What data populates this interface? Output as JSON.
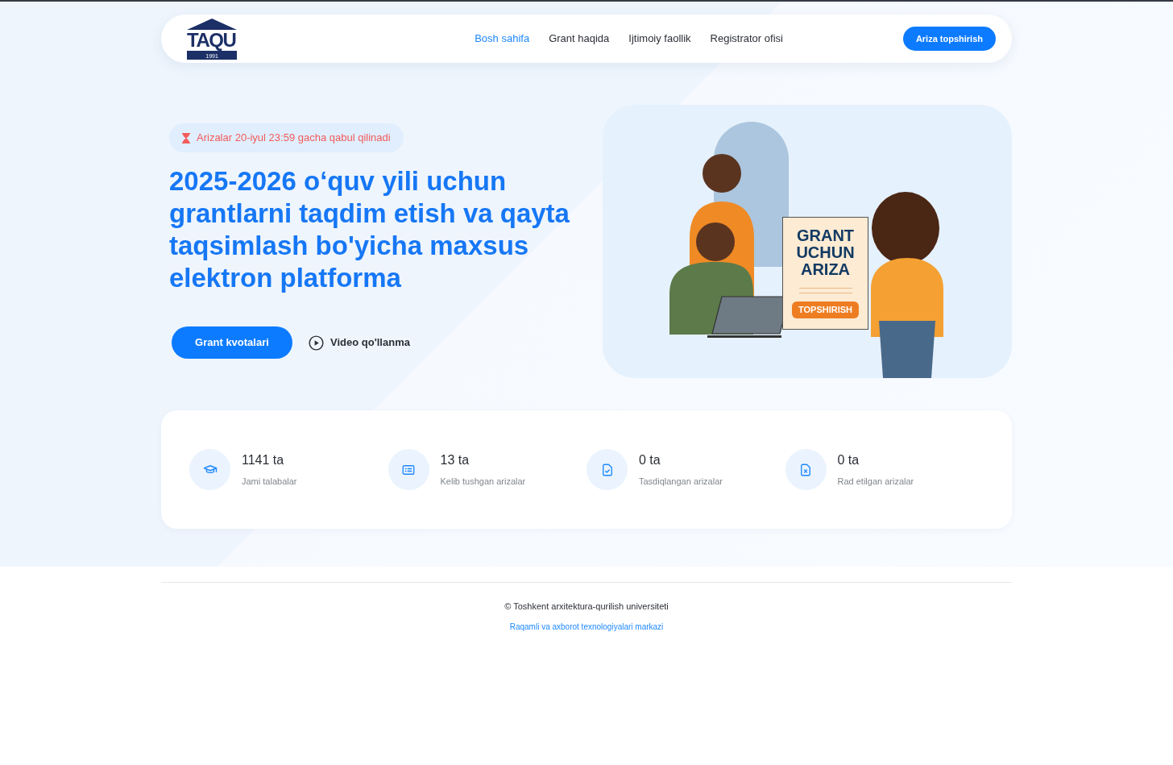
{
  "header": {
    "logo": {
      "text": "TAQU",
      "year": "1991"
    },
    "nav": [
      {
        "label": "Bosh sahifa",
        "selected": true
      },
      {
        "label": "Grant haqida",
        "selected": false
      },
      {
        "label": "Ijtimoiy faollik",
        "selected": false
      },
      {
        "label": "Registrator ofisi",
        "selected": false
      }
    ],
    "cta": "Ariza topshirish"
  },
  "hero": {
    "deadline": "Arizalar 20-iyul 23:59 gacha qabul qilinadi",
    "title": "2025-2026 o‘quv yili uchun grantlarni taqdim etish va qayta taqsimlash bo'yicha maxsus elektron platforma",
    "primary_button": "Grant kvotalari",
    "video_link": "Video qo'llanma",
    "illustration": {
      "poster_lines": [
        "GRANT",
        "UCHUN",
        "ARIZA"
      ],
      "poster_button": "TOPSHIRISH"
    }
  },
  "stats": [
    {
      "kind": "students",
      "value": "1141 ta",
      "label": "Jami talabalar"
    },
    {
      "kind": "received",
      "value": "13 ta",
      "label": "Kelib tushgan arizalar"
    },
    {
      "kind": "approved",
      "value": "0 ta",
      "label": "Tasdiqlangan arizalar"
    },
    {
      "kind": "rejected",
      "value": "0 ta",
      "label": "Rad etilgan arizalar"
    }
  ],
  "footer": {
    "copyright": "© Toshkent arxitektura-qurilish universiteti",
    "credit": "Raqamli va axborot texnologiyalari markazi"
  }
}
